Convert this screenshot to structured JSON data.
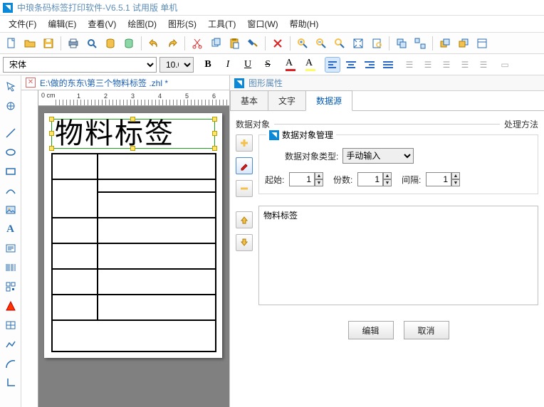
{
  "app": {
    "title": "中琅条码标签打印软件-V6.5.1 试用版 单机"
  },
  "menu": {
    "file": "文件(F)",
    "edit": "编辑(E)",
    "view": "查看(V)",
    "draw": "绘图(D)",
    "shape": "图形(S)",
    "tools": "工具(T)",
    "window": "窗口(W)",
    "help": "帮助(H)"
  },
  "font": {
    "name": "宋体",
    "size": "10.0"
  },
  "document": {
    "tab_label": "E:\\做的东东\\第三个物料标签 .zhl *"
  },
  "ruler": {
    "unit_label": "0 cm",
    "marks": [
      "1",
      "2",
      "3",
      "4",
      "5",
      "6"
    ]
  },
  "canvas_text": "物料标签",
  "panel": {
    "title": "图形属性",
    "tabs": {
      "basic": "基本",
      "text": "文字",
      "data": "数据源"
    },
    "section_left": "数据对象",
    "section_right": "处理方法",
    "form_header": "数据对象管理",
    "type_label": "数据对象类型:",
    "type_value": "手动输入",
    "start_label": "起始:",
    "start_value": "1",
    "count_label": "份数:",
    "count_value": "1",
    "gap_label": "间隔:",
    "gap_value": "1",
    "textarea_value": "物料标签",
    "btn_edit": "编辑",
    "btn_cancel": "取消"
  }
}
